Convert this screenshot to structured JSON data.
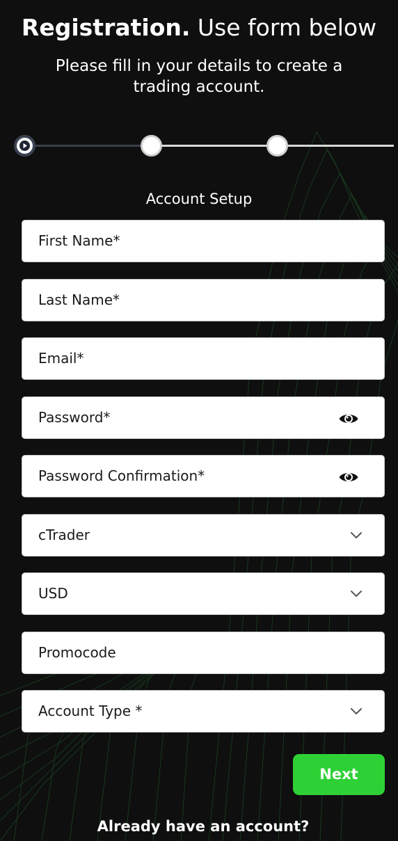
{
  "header": {
    "title_strong": "Registration.",
    "title_light": "Use form below",
    "subtitle": "Please fill in your details to create a trading account."
  },
  "stepper": {
    "total_steps": 3,
    "current_step": 1,
    "active_icon": "play-icon"
  },
  "form": {
    "section_title": "Account Setup",
    "first_name_placeholder": "First Name*",
    "last_name_placeholder": "Last Name*",
    "email_placeholder": "Email*",
    "password_placeholder": "Password*",
    "password_confirm_placeholder": "Password Confirmation*",
    "platform_value": "cTrader",
    "currency_value": "USD",
    "promocode_placeholder": "Promocode",
    "account_type_placeholder": "Account Type *",
    "password_icon": "eye-icon",
    "select_icon": "chevron-down-icon"
  },
  "actions": {
    "next_label": "Next",
    "login_prompt": "Already have an account?"
  },
  "colors": {
    "background": "#0f0f0f",
    "accent": "#2ed135",
    "mesh": "#1f5a2a"
  }
}
